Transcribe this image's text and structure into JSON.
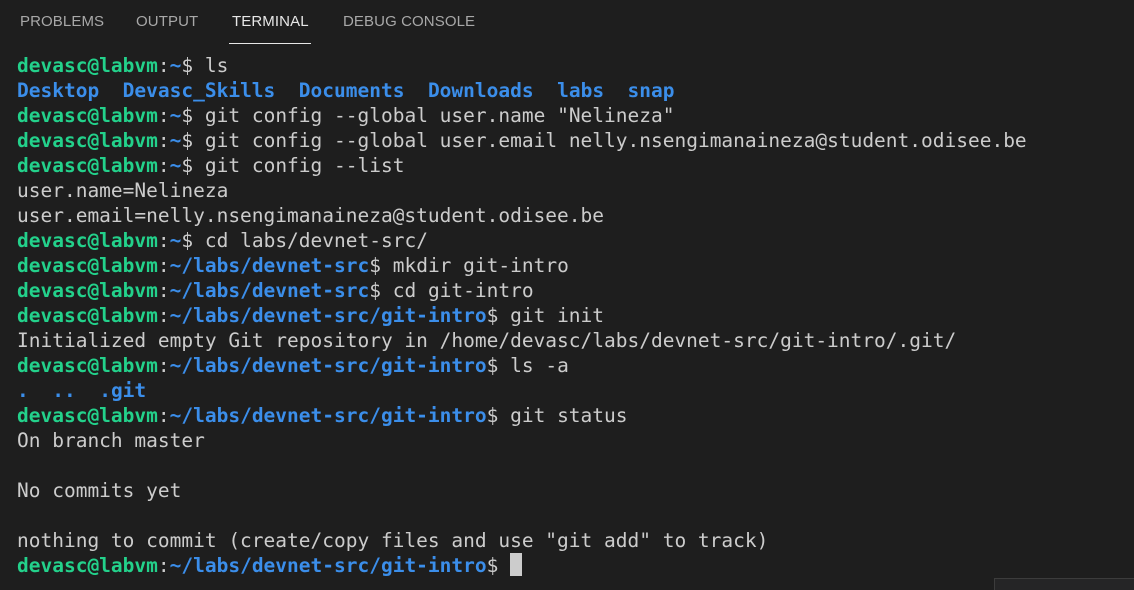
{
  "panel": {
    "tabs": [
      {
        "label": "PROBLEMS"
      },
      {
        "label": "OUTPUT"
      },
      {
        "label": "TERMINAL"
      },
      {
        "label": "DEBUG CONSOLE"
      }
    ],
    "active_tab": "TERMINAL"
  },
  "terminal": {
    "prompt": {
      "user": "devasc@labvm",
      "colon": ":",
      "dollar": "$ "
    },
    "lines": [
      {
        "path": "~",
        "cmd": "ls"
      },
      {
        "dirs": [
          "Desktop",
          "Devasc_Skills",
          "Documents",
          "Downloads",
          "labs",
          "snap"
        ]
      },
      {
        "path": "~",
        "cmd": "git config --global user.name \"Nelineza\""
      },
      {
        "path": "~",
        "cmd": "git config --global user.email nelly.nsengimanaineza@student.odisee.be"
      },
      {
        "path": "~",
        "cmd": "git config --list"
      },
      {
        "text": "user.name=Nelineza"
      },
      {
        "text": "user.email=nelly.nsengimanaineza@student.odisee.be"
      },
      {
        "path": "~",
        "cmd": "cd labs/devnet-src/"
      },
      {
        "path": "~/labs/devnet-src",
        "cmd": "mkdir git-intro"
      },
      {
        "path": "~/labs/devnet-src",
        "cmd": "cd git-intro"
      },
      {
        "path": "~/labs/devnet-src/git-intro",
        "cmd": "git init"
      },
      {
        "text": "Initialized empty Git repository in /home/devasc/labs/devnet-src/git-intro/.git/"
      },
      {
        "path": "~/labs/devnet-src/git-intro",
        "cmd": "ls -a"
      },
      {
        "dirs": [
          ".",
          "..",
          ".git"
        ]
      },
      {
        "path": "~/labs/devnet-src/git-intro",
        "cmd": "git status"
      },
      {
        "text": "On branch master"
      },
      {
        "text": ""
      },
      {
        "text": "No commits yet"
      },
      {
        "text": ""
      },
      {
        "text": "nothing to commit (create/copy files and use \"git add\" to track)"
      },
      {
        "path": "~/labs/devnet-src/git-intro",
        "cmd": ""
      }
    ]
  },
  "colors": {
    "background": "#1e1e1e",
    "user": "#23d18b",
    "path": "#3b8eea",
    "text": "#cccccc",
    "tab_inactive": "#a8a8a8",
    "tab_active": "#e7e7e7"
  }
}
